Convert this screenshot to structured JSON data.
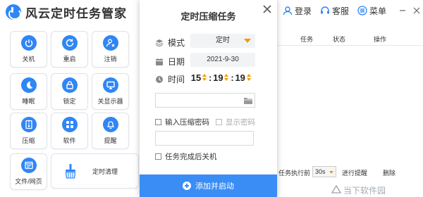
{
  "app": {
    "title": "风云定时任务管家",
    "login": "登录",
    "service": "客服",
    "menu": "菜单"
  },
  "tiles": [
    {
      "id": "shutdown",
      "label": "关机",
      "icon": "power-icon"
    },
    {
      "id": "restart",
      "label": "重启",
      "icon": "restart-icon"
    },
    {
      "id": "logout",
      "label": "注销",
      "icon": "user-logout-icon"
    },
    {
      "id": "sleep",
      "label": "睡眠",
      "icon": "moon-icon"
    },
    {
      "id": "lock",
      "label": "锁定",
      "icon": "lock-icon"
    },
    {
      "id": "display-off",
      "label": "关显示器",
      "icon": "monitor-icon"
    },
    {
      "id": "compress",
      "label": "压缩",
      "icon": "archive-icon"
    },
    {
      "id": "software",
      "label": "软件",
      "icon": "apps-icon"
    },
    {
      "id": "reminder",
      "label": "提醒",
      "icon": "bell-icon"
    },
    {
      "id": "file-web",
      "label": "文件/网页",
      "icon": "browser-icon"
    },
    {
      "id": "timed-clean",
      "label": "定时清理",
      "icon": "broom-icon"
    }
  ],
  "table": {
    "col_task": "任务",
    "col_status": "状态",
    "col_action": "操作"
  },
  "bottom": {
    "task_exec_label": "任务执行前",
    "interval_value": "30s",
    "remind_label": "进行提醒",
    "delete_label": "删除"
  },
  "watermark": "当下软件园",
  "modal": {
    "title": "定时压缩任务",
    "mode_label": "模式",
    "mode_value": "定时",
    "date_label": "日期",
    "date_value": "2021-9-30",
    "time_label": "时间",
    "hour": "15",
    "minute": "19",
    "second": "19",
    "path_value": "",
    "password_option": "输入压缩密码",
    "show_password": "显示密码",
    "password_value": "",
    "shutdown_after": "任务完成后关机",
    "submit_label": "添加并启动"
  },
  "colors": {
    "accent": "#2f86f6",
    "button": "#3a8df5",
    "arrow": "#f39800"
  }
}
